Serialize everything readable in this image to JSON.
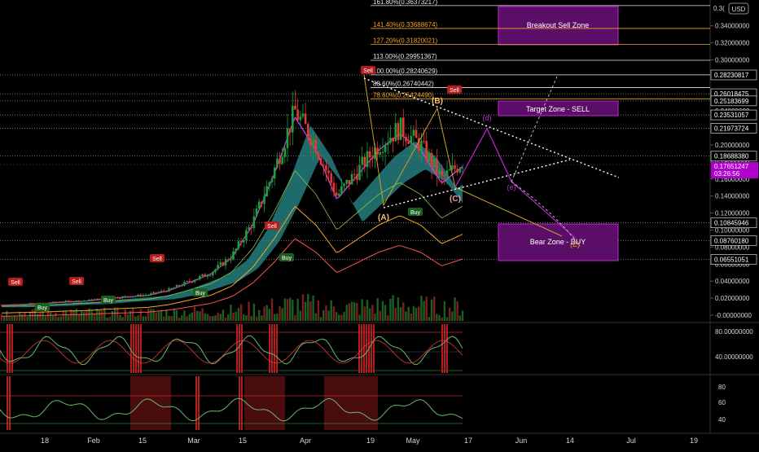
{
  "colors": {
    "background": "#000000",
    "candle_up": "#26a69a",
    "candle_green": "#1f9d3a",
    "candle_down": "#e53935",
    "cloud": "#2a8f8f",
    "fib_white": "#e8e8e8",
    "fib_orange": "#f5a623",
    "zone_magenta": "#c026d3",
    "wave_yellow": "#c9a227",
    "projection_purple": "#c026d3",
    "current_price_bg": "#b100cd"
  },
  "price_axis": {
    "currency": "USD",
    "top_label": "0.3(",
    "ticks": [
      "0.34000000",
      "0.32000000",
      "0.30000000",
      "0.28000000",
      "0.26000000",
      "0.24000000",
      "0.22000000",
      "0.20000000",
      "0.18000000",
      "0.16000000",
      "0.14000000",
      "0.12000000",
      "0.10000000",
      "0.08000000",
      "0.06000000",
      "0.04000000",
      "0.02000000",
      "-0.00000000"
    ],
    "level_badges": [
      "0.28230817",
      "0.26018475",
      "0.25183699",
      "0.23531057",
      "0.21973724",
      "0.18688380",
      "0.10845946",
      "0.08760180",
      "0.06551051"
    ],
    "current_price": "0.17651247",
    "countdown": "03:26:56"
  },
  "time_axis": {
    "labels": [
      "18",
      "Feb",
      "15",
      "Mar",
      "15",
      "Apr",
      "19",
      "May",
      "17",
      "Jun",
      "14",
      "Jul",
      "19"
    ]
  },
  "fib_levels": [
    {
      "label": "161.80%(0.36373217)",
      "color": "white"
    },
    {
      "label": "141.40%(0.33688674)",
      "color": "orange"
    },
    {
      "label": "127.20%(0.31820021)",
      "color": "orange"
    },
    {
      "label": "113.00%(0.29951367)",
      "color": "white"
    },
    {
      "label": "100.00%(0.28240629)",
      "color": "white"
    },
    {
      "label": "88.60%(0.26740442)",
      "color": "white"
    },
    {
      "label": "78.60%(0.25424490)",
      "color": "orange"
    }
  ],
  "zones": {
    "breakout": "Breakout Sell Zone",
    "target": "Target Zone - SELL",
    "bear": "Bear Zone - BUY"
  },
  "wave_labels": {
    "A": "(A)",
    "B": "(B)",
    "C": "(C)",
    "d": "(d)",
    "e": "(e)",
    "E": "(E)"
  },
  "signals": {
    "sell": "Sell",
    "buy": "Buy"
  },
  "oscillator_1": {
    "ticks": [
      "80.00000000",
      "40.00000000"
    ]
  },
  "oscillator_2": {
    "ticks": [
      "80",
      "60",
      "40"
    ]
  },
  "chart_data": {
    "type": "candlestick",
    "y_range": [
      -0.004,
      0.37
    ],
    "prices_note": "",
    "trend": [
      0.012,
      0.013,
      0.014,
      0.016,
      0.017,
      0.02,
      0.022,
      0.024,
      0.03,
      0.04,
      0.05,
      0.07,
      0.11,
      0.17,
      0.24,
      0.2,
      0.14,
      0.17,
      0.2,
      0.22,
      0.2,
      0.16,
      0.18
    ],
    "fib_levels": [
      0.36373217,
      0.33688674,
      0.31820021,
      0.29951367,
      0.28240629,
      0.26740442,
      0.2542449
    ],
    "levels": [
      0.28230817,
      0.26018475,
      0.25183699,
      0.23531057,
      0.21973724,
      0.1868838,
      0.10845946,
      0.0876018,
      0.06551051
    ],
    "current_price": 0.17651247
  }
}
